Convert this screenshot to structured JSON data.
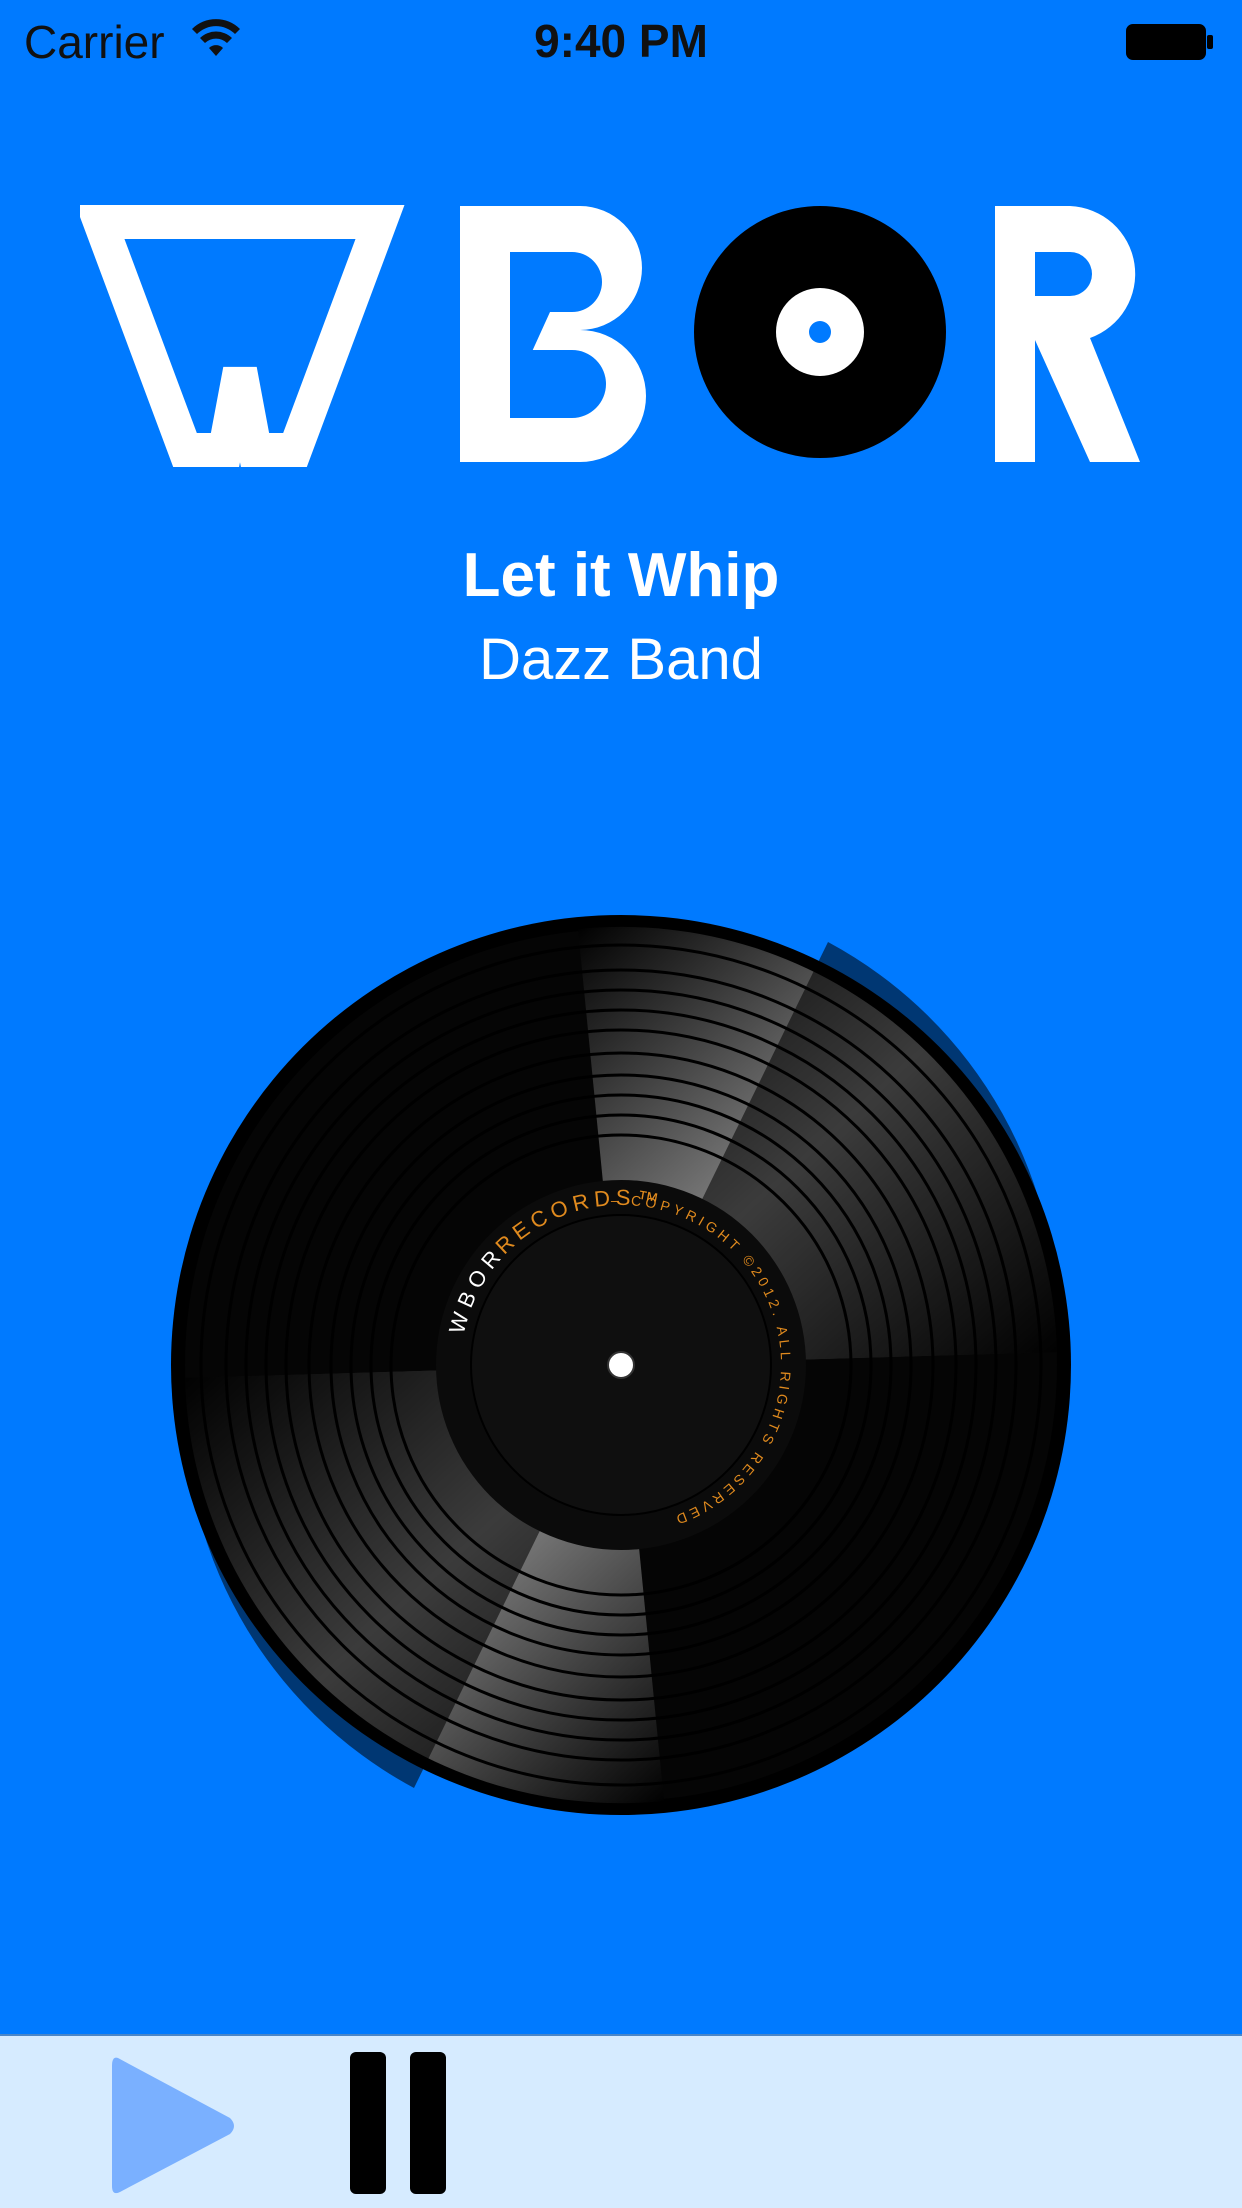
{
  "status_bar": {
    "carrier": "Carrier",
    "time": "9:40 PM",
    "wifi_icon": "wifi-icon",
    "battery_icon": "battery-icon"
  },
  "logo": {
    "text": "WBOR",
    "icon": "wbor-logo"
  },
  "now_playing": {
    "title": "Let it Whip",
    "artist": "Dazz Band"
  },
  "record": {
    "icon": "vinyl-record-icon",
    "label_brand": "WBOR",
    "label_records": "RECORDS™",
    "label_copyright": "– COPYRIGHT ©2012. ALL RIGHTS RESERVED"
  },
  "player": {
    "play_icon": "play-icon",
    "pause_icon": "pause-icon"
  },
  "colors": {
    "background": "#007AFF",
    "player_bar": "#D6EBFF",
    "play_button": "#7AB0FF",
    "pause_button": "#000000",
    "label_text_orange": "#E08A1E"
  }
}
